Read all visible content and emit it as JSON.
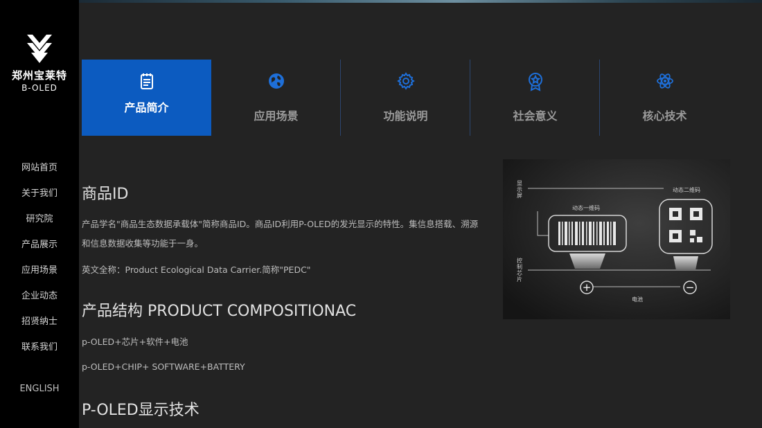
{
  "brand": {
    "name_cn": "郑州宝莱特",
    "name_en": "B-OLED"
  },
  "nav": [
    {
      "label": "网站首页"
    },
    {
      "label": "关于我们"
    },
    {
      "label": "研究院"
    },
    {
      "label": "产品展示"
    },
    {
      "label": "应用场景"
    },
    {
      "label": "企业动态"
    },
    {
      "label": "招贤纳士"
    },
    {
      "label": "联系我们"
    }
  ],
  "lang": "ENGLISH",
  "tabs": [
    {
      "label": "产品简介",
      "icon": "document-icon",
      "active": true
    },
    {
      "label": "应用场景",
      "icon": "globe-icon"
    },
    {
      "label": "功能说明",
      "icon": "gear-icon"
    },
    {
      "label": "社会意义",
      "icon": "badge-icon"
    },
    {
      "label": "核心技术",
      "icon": "atom-icon"
    }
  ],
  "article": {
    "title": "商品ID",
    "para1_line1": "产品学名\"商品生态数据承载体\"简称商品ID。商品ID利用P-OLED的发光显示的特性。集信息搭载、溯源",
    "para1_line2": "和信息数据收集等功能于一身。",
    "english_name": "英文全称：Product Ecological Data Carrier.简称\"PEDC\"",
    "section2_title": "产品结构 PRODUCT COMPOSITIONAC",
    "composition_cn": "p-OLED+芯片+软件+电池",
    "composition_en": "p-OLED+CHIP+ SOFTWARE+BATTERY",
    "section3_title": "P-OLED显示技术"
  },
  "diagram": {
    "label_screen": "显示屏",
    "label_chip": "控制芯片",
    "label_barcode": "动态一维码",
    "label_qrcode": "动态二维码",
    "label_battery": "电池",
    "plus": "+",
    "minus": "−"
  },
  "colors": {
    "accent": "#0c5bc0",
    "icon_blue": "#1e6fd9",
    "sidebar_bg": "#000000",
    "page_bg": "#232323"
  }
}
